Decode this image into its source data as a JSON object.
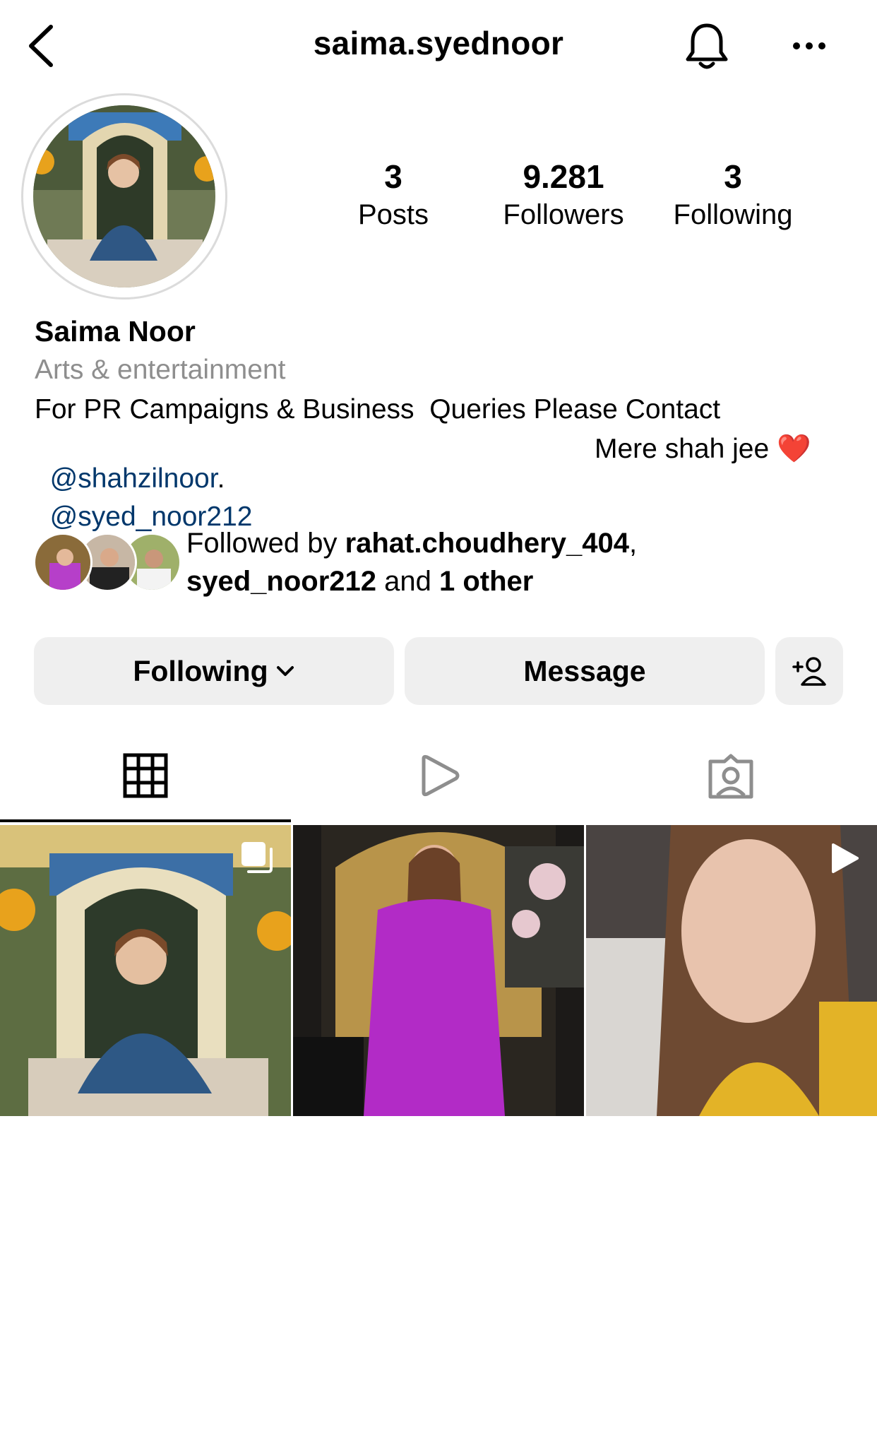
{
  "header": {
    "username": "saima.syednoor",
    "back_icon": "chevron-left-icon",
    "notifications_icon": "bell-icon",
    "more_icon": "more-horizontal-icon"
  },
  "stats": [
    {
      "value": "3",
      "label": "Posts"
    },
    {
      "value": "9.281",
      "label": "Followers"
    },
    {
      "value": "3",
      "label": "Following"
    }
  ],
  "bio": {
    "name": "Saima Noor",
    "category": "Arts & entertainment",
    "line1": "For PR Campaigns & Business  Queries Please Contact",
    "line2_link": "@shahzilnoor",
    "line2_dot": ".",
    "line2_tail": "Mere shah jee ❤️",
    "line3_link": "@syed_noor212"
  },
  "followed_by": {
    "prefix": "Followed by ",
    "user1": "rahat.choudhery_404",
    "sep": ",",
    "user2": "syed_noor212",
    "and": " and ",
    "others": "1 other"
  },
  "actions": {
    "following_label": "Following",
    "message_label": "Message",
    "add_user_icon": "add-user-icon"
  },
  "tabs": [
    {
      "icon": "grid-icon",
      "active": true
    },
    {
      "icon": "reels-icon",
      "active": false
    },
    {
      "icon": "tagged-icon",
      "active": false
    }
  ],
  "colors": {
    "link": "#00376b",
    "secondary_text": "#8e8e8e",
    "button_bg": "#efefef",
    "heart": "#e0245e"
  }
}
